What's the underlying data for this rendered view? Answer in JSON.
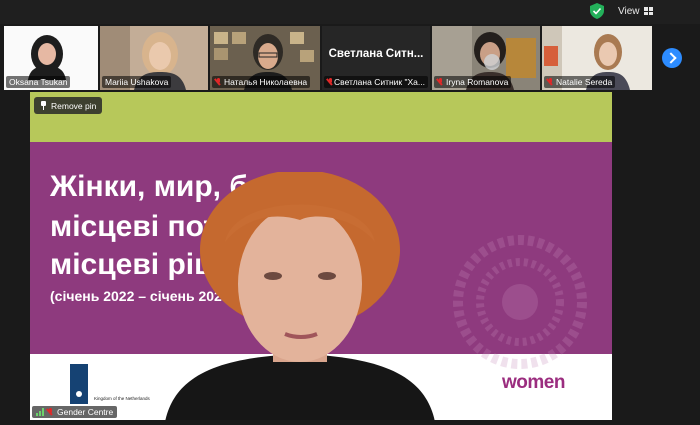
{
  "topbar": {
    "view_label": "View"
  },
  "participants": [
    {
      "name": "Oksana Tsukan",
      "muted": false
    },
    {
      "name": "Mariia Ushakova",
      "muted": false
    },
    {
      "name": "Наталья Николаевна",
      "muted": true
    },
    {
      "name": "Светлана Ситник \"Ха...",
      "muted": true,
      "display_name": "Светлана  Ситн..."
    },
    {
      "name": "Iryna Romanova",
      "muted": true
    },
    {
      "name": "Natalie Sereda",
      "muted": true
    }
  ],
  "share": {
    "remove_pin_label": "Remove pin",
    "slide": {
      "line1": "Жінки, мир, без",
      "line2": "місцеві потр",
      "line3": "місцеві ріше",
      "line4": "(січень 2022 – січень 2025)",
      "nl_text": "Kingdom of the Netherlands",
      "women_logo": "women"
    },
    "speaker_label": "Gender Centre"
  },
  "colors": {
    "accent": "#2d8cff",
    "slide_green": "#b7c85a",
    "slide_purple": "#8e3a7e",
    "muted_red": "#e02828"
  }
}
